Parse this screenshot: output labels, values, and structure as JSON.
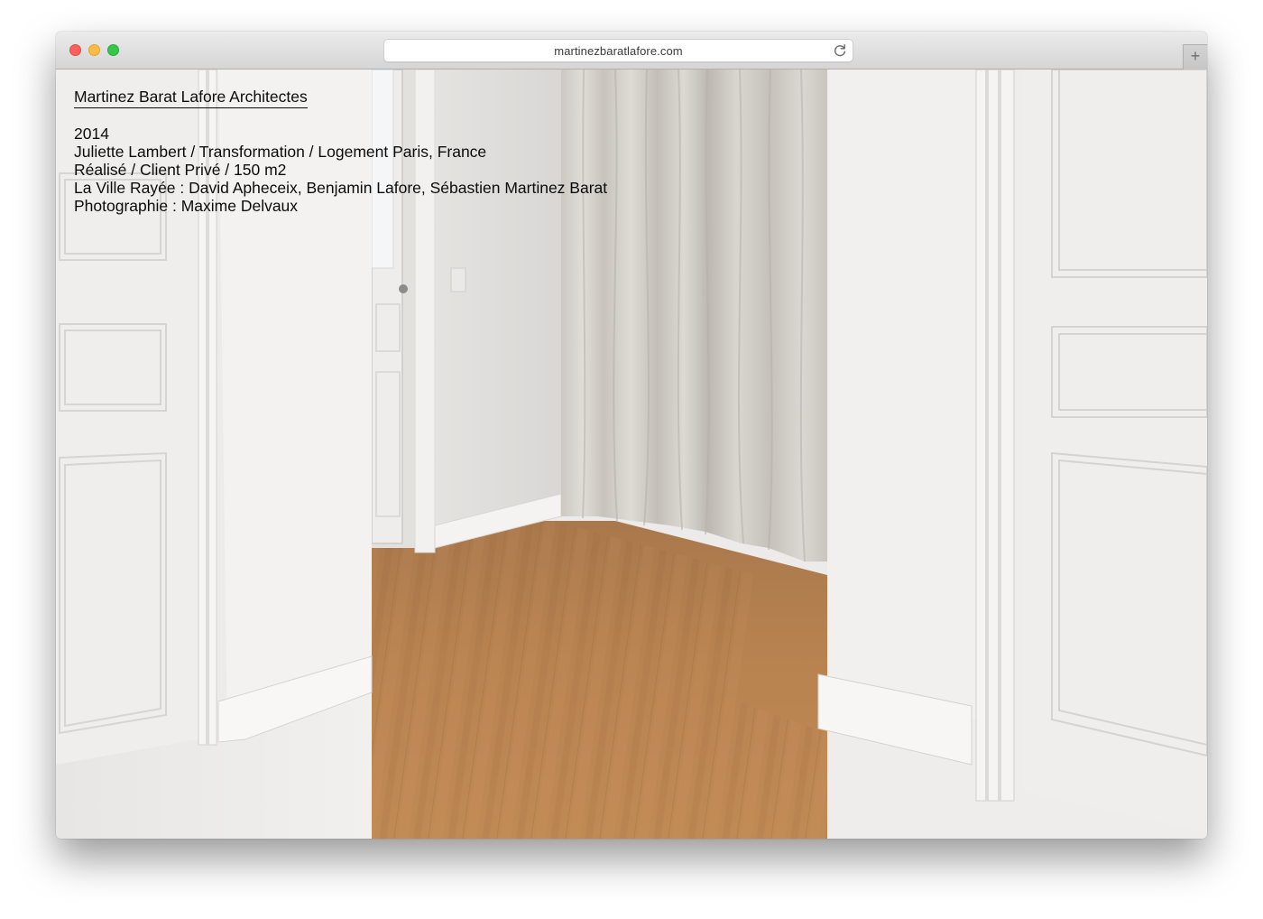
{
  "browser": {
    "url": "martinezbaratlafore.com",
    "reload_icon": "reload-icon",
    "new_tab_label": "+",
    "window_controls": [
      "close",
      "minimize",
      "maximize"
    ]
  },
  "site": {
    "brand": "Martinez Barat Lafore Architectes",
    "project": {
      "year": "2014",
      "title": "Juliette Lambert / Transformation / Logement Paris, France",
      "status": "Réalisé / Client Privé / 150 m2",
      "team": "La Ville Rayée : David Apheceix, Benjamin Lafore, Sébastien Martinez Barat",
      "photography": "Photographie : Maxime Delvaux"
    }
  },
  "colors": {
    "close": "#fc605b",
    "minimize": "#fdbc40",
    "maximize": "#34c84a",
    "text": "#0c0c0c",
    "wall": "#ecebe9",
    "floor": "#b07a48"
  }
}
